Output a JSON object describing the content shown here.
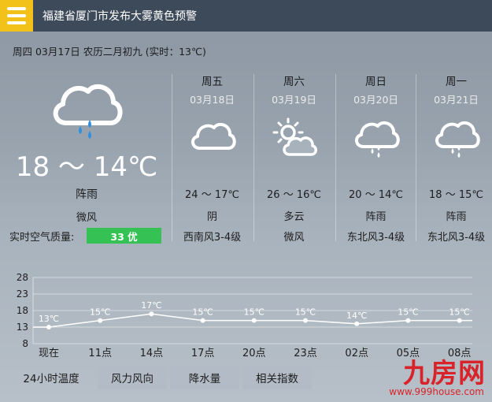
{
  "header": {
    "title": "福建省厦门市发布大雾黄色预警"
  },
  "today": {
    "date_line": "周四 03月17日 农历二月初九 (实时：13℃)",
    "temp_range": "18 ～ 14℃",
    "condition": "阵雨",
    "wind": "微风",
    "aq_label": "实时空气质量:",
    "aq_value": "33 优",
    "icon": "rain-cloud-icon"
  },
  "forecast": [
    {
      "day": "周五",
      "date": "03月18日",
      "temp": "24 ～ 17℃",
      "condition": "阴",
      "wind": "西南风3-4级",
      "icon": "cloud-icon"
    },
    {
      "day": "周六",
      "date": "03月19日",
      "temp": "26 ～ 16℃",
      "condition": "多云",
      "wind": "微风",
      "icon": "partly-cloudy-icon"
    },
    {
      "day": "周日",
      "date": "03月20日",
      "temp": "20 ～ 14℃",
      "condition": "阵雨",
      "wind": "东北风3-4级",
      "icon": "rain-cloud-icon"
    },
    {
      "day": "周一",
      "date": "03月21日",
      "temp": "18 ～ 15℃",
      "condition": "阵雨",
      "wind": "东北风3-4级",
      "icon": "rain-cloud-icon"
    }
  ],
  "chart_data": {
    "type": "line",
    "y_ticks": [
      "28",
      "23",
      "18",
      "13",
      "8"
    ],
    "ylim": [
      8,
      28
    ],
    "categories": [
      "现在",
      "11点",
      "14点",
      "17点",
      "20点",
      "23点",
      "02点",
      "05点",
      "08点"
    ],
    "series": [
      {
        "values": [
          13,
          15,
          17,
          15,
          15,
          15,
          14,
          15,
          15
        ],
        "labels": [
          "13℃",
          "15℃",
          "17℃",
          "15℃",
          "15℃",
          "15℃",
          "14℃",
          "15℃",
          "15℃"
        ]
      }
    ]
  },
  "tabs": [
    "24小时温度",
    "风力风向",
    "降水量",
    "相关指数"
  ],
  "logo": {
    "text": "九房网",
    "url": "www.999house.com"
  },
  "colors": {
    "accent": "#f2c21a",
    "header_bg": "#3d4a5a",
    "aq_good": "#35c154",
    "logo": "#d9232a"
  }
}
